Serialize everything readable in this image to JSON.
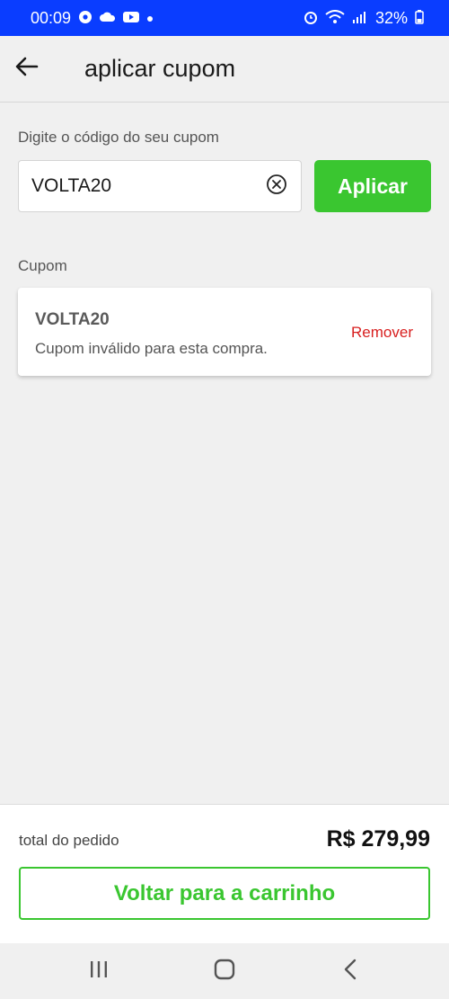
{
  "status_bar": {
    "time": "00:09",
    "battery": "32%"
  },
  "header": {
    "title": "aplicar cupom"
  },
  "coupon_input": {
    "label": "Digite o código do seu cupom",
    "value": "VOLTA20",
    "apply_label": "Aplicar"
  },
  "coupon_section": {
    "label": "Cupom",
    "code": "VOLTA20",
    "message": "Cupom inválido para esta compra.",
    "remove_label": "Remover"
  },
  "footer": {
    "total_label": "total do pedido",
    "total_value": "R$ 279,99",
    "back_to_cart_label": "Voltar para a carrinho"
  },
  "colors": {
    "status_bar": "#0a3dff",
    "primary_green": "#3ac630",
    "error_red": "#d81f1f"
  },
  "icons": {
    "back": "arrow-left-icon",
    "clear": "clear-circle-icon",
    "nav_recent": "recent-apps-icon",
    "nav_home": "home-icon",
    "nav_back": "chevron-left-icon"
  }
}
